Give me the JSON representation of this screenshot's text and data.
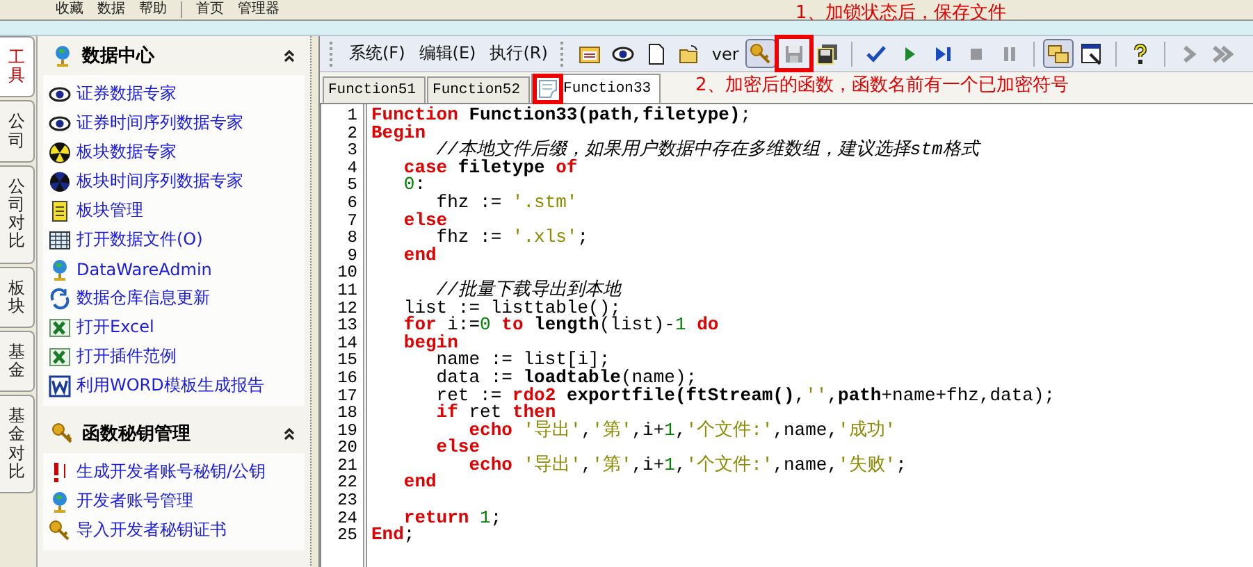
{
  "top_bar": {
    "menus": [
      "收藏",
      "数据",
      "帮助"
    ],
    "tabs": [
      "首页",
      "管理器"
    ]
  },
  "side_tabs": [
    {
      "label": "工具",
      "selected": true
    },
    {
      "label": "公司",
      "selected": false
    },
    {
      "label": "公司对比",
      "selected": false
    },
    {
      "label": "板块",
      "selected": false
    },
    {
      "label": "基金",
      "selected": false
    },
    {
      "label": "基金对比",
      "selected": false
    }
  ],
  "sections": [
    {
      "title": "数据中心",
      "kind": "globe",
      "expanded": true,
      "items": [
        {
          "label": "证券数据专家",
          "kind": "eye"
        },
        {
          "label": "证券时间序列数据专家",
          "kind": "eye"
        },
        {
          "label": "板块数据专家",
          "kind": "radiation"
        },
        {
          "label": "板块时间序列数据专家",
          "kind": "dark-radiation"
        },
        {
          "label": "板块管理",
          "kind": "note"
        },
        {
          "label": "打开数据文件(O)",
          "kind": "grid"
        },
        {
          "label": "DataWareAdmin",
          "kind": "globe"
        },
        {
          "label": "数据仓库信息更新",
          "kind": "refresh"
        },
        {
          "label": "打开Excel",
          "kind": "excel"
        },
        {
          "label": "打开插件范例",
          "kind": "excel"
        },
        {
          "label": "利用WORD模板生成报告",
          "kind": "word"
        }
      ]
    },
    {
      "title": "函数秘钥管理",
      "kind": "key",
      "expanded": true,
      "items": [
        {
          "label": "生成开发者账号秘钥/公钥",
          "kind": "alert"
        },
        {
          "label": "开发者账号管理",
          "kind": "globe"
        },
        {
          "label": "导入开发者秘钥证书",
          "kind": "key"
        }
      ]
    }
  ],
  "menu": [
    "系统(F)",
    "编辑(E)",
    "执行(R)"
  ],
  "toolbar": [
    {
      "kind": "calendar",
      "pressed": false,
      "disabled": false
    },
    {
      "kind": "eye",
      "pressed": false,
      "disabled": false
    },
    {
      "kind": "new",
      "pressed": false,
      "disabled": false
    },
    {
      "kind": "open",
      "pressed": false,
      "disabled": false
    },
    {
      "kind": "text",
      "label": "ver",
      "pressed": false,
      "disabled": false
    },
    {
      "kind": "key",
      "pressed": true,
      "disabled": false
    },
    {
      "kind": "save",
      "pressed": false,
      "disabled": true,
      "highlighted": true
    },
    {
      "kind": "save-all",
      "pressed": false,
      "disabled": false
    },
    {
      "kind": "sep"
    },
    {
      "kind": "check",
      "pressed": false,
      "disabled": false
    },
    {
      "kind": "play",
      "pressed": false,
      "disabled": false
    },
    {
      "kind": "step",
      "pressed": false,
      "disabled": false
    },
    {
      "kind": "stop",
      "pressed": false,
      "disabled": true
    },
    {
      "kind": "pause",
      "pressed": false,
      "disabled": true
    },
    {
      "kind": "sep"
    },
    {
      "kind": "folders",
      "pressed": true,
      "disabled": false
    },
    {
      "kind": "window",
      "pressed": false,
      "disabled": false
    },
    {
      "kind": "sep"
    },
    {
      "kind": "help",
      "pressed": false,
      "disabled": false
    },
    {
      "kind": "sep"
    },
    {
      "kind": "next",
      "pressed": false,
      "disabled": true
    },
    {
      "kind": "last",
      "pressed": false,
      "disabled": true
    }
  ],
  "tabs": [
    {
      "label": "Function51",
      "selected": false,
      "encrypted": false
    },
    {
      "label": "Function52",
      "selected": false,
      "encrypted": false
    },
    {
      "label": "Function33",
      "selected": true,
      "encrypted": true,
      "highlighted": true
    }
  ],
  "annotations": [
    "1、加锁状态后，保存文件",
    "2、加密后的函数，函数名前有一个已加密符号"
  ],
  "code": [
    {
      "number": "1",
      "tokens": [
        {
          "kind": "kw",
          "text": "Function"
        },
        {
          "kind": "id",
          "text": " Function33(path,filetype)"
        },
        {
          "kind": "tx",
          "text": ";"
        }
      ]
    },
    {
      "number": "2",
      "tokens": [
        {
          "kind": "kw",
          "text": "Begin"
        }
      ]
    },
    {
      "number": "3",
      "tokens": [
        {
          "kind": "cm",
          "text": "      //本地文件后缀，如果用户数据中存在多维数组，建议选择stm格式"
        }
      ]
    },
    {
      "number": "4",
      "tokens": [
        {
          "kind": "kw",
          "text": "   case"
        },
        {
          "kind": "id",
          "text": " filetype"
        },
        {
          "kind": "kw",
          "text": " of"
        }
      ]
    },
    {
      "number": "5",
      "tokens": [
        {
          "kind": "num",
          "text": "   0"
        },
        {
          "kind": "tx",
          "text": ":"
        }
      ]
    },
    {
      "number": "6",
      "tokens": [
        {
          "kind": "tx",
          "text": "      fhz := "
        },
        {
          "kind": "str",
          "text": "'.stm'"
        }
      ]
    },
    {
      "number": "7",
      "tokens": [
        {
          "kind": "kw",
          "text": "   else"
        }
      ]
    },
    {
      "number": "8",
      "tokens": [
        {
          "kind": "tx",
          "text": "      fhz := "
        },
        {
          "kind": "str",
          "text": "'.xls'"
        },
        {
          "kind": "tx",
          "text": ";"
        }
      ]
    },
    {
      "number": "9",
      "tokens": [
        {
          "kind": "kw",
          "text": "   end"
        }
      ]
    },
    {
      "number": "10"
    },
    {
      "number": "11",
      "tokens": [
        {
          "kind": "cm",
          "text": "      //批量下载导出到本地"
        }
      ]
    },
    {
      "number": "12",
      "tokens": [
        {
          "kind": "tx",
          "text": "   list := listtable();"
        }
      ]
    },
    {
      "number": "13",
      "tokens": [
        {
          "kind": "kw",
          "text": "   for"
        },
        {
          "kind": "tx",
          "text": " i:="
        },
        {
          "kind": "num",
          "text": "0"
        },
        {
          "kind": "kw",
          "text": " to"
        },
        {
          "kind": "id",
          "text": " length"
        },
        {
          "kind": "tx",
          "text": "(list)-"
        },
        {
          "kind": "num",
          "text": "1"
        },
        {
          "kind": "kw",
          "text": " do"
        }
      ]
    },
    {
      "number": "14",
      "tokens": [
        {
          "kind": "kw",
          "text": "   begin"
        }
      ]
    },
    {
      "number": "15",
      "tokens": [
        {
          "kind": "tx",
          "text": "      name := list[i];"
        }
      ]
    },
    {
      "number": "16",
      "tokens": [
        {
          "kind": "tx",
          "text": "      data := "
        },
        {
          "kind": "id",
          "text": "loadtable"
        },
        {
          "kind": "tx",
          "text": "(name);"
        }
      ]
    },
    {
      "number": "17",
      "tokens": [
        {
          "kind": "tx",
          "text": "      ret := "
        },
        {
          "kind": "kw",
          "text": "rdo2"
        },
        {
          "kind": "id",
          "text": " exportfile(ftStream()"
        },
        {
          "kind": "tx",
          "text": ","
        },
        {
          "kind": "str",
          "text": "''"
        },
        {
          "kind": "tx",
          "text": ","
        },
        {
          "kind": "id",
          "text": "path"
        },
        {
          "kind": "tx",
          "text": "+name+fhz,data);"
        }
      ]
    },
    {
      "number": "18",
      "tokens": [
        {
          "kind": "kw",
          "text": "      if"
        },
        {
          "kind": "tx",
          "text": " ret "
        },
        {
          "kind": "kw",
          "text": "then"
        }
      ]
    },
    {
      "number": "19",
      "tokens": [
        {
          "kind": "kw",
          "text": "         echo"
        },
        {
          "kind": "str",
          "text": " '导出'"
        },
        {
          "kind": "tx",
          "text": ","
        },
        {
          "kind": "str",
          "text": "'第'"
        },
        {
          "kind": "tx",
          "text": ",i+"
        },
        {
          "kind": "num",
          "text": "1"
        },
        {
          "kind": "tx",
          "text": ","
        },
        {
          "kind": "str",
          "text": "'个文件:'"
        },
        {
          "kind": "tx",
          "text": ",name,"
        },
        {
          "kind": "str",
          "text": "'成功'"
        }
      ]
    },
    {
      "number": "20",
      "tokens": [
        {
          "kind": "kw",
          "text": "      else"
        }
      ]
    },
    {
      "number": "21",
      "tokens": [
        {
          "kind": "kw",
          "text": "         echo"
        },
        {
          "kind": "str",
          "text": " '导出'"
        },
        {
          "kind": "tx",
          "text": ","
        },
        {
          "kind": "str",
          "text": "'第'"
        },
        {
          "kind": "tx",
          "text": ",i+"
        },
        {
          "kind": "num",
          "text": "1"
        },
        {
          "kind": "tx",
          "text": ","
        },
        {
          "kind": "str",
          "text": "'个文件:'"
        },
        {
          "kind": "tx",
          "text": ",name,"
        },
        {
          "kind": "str",
          "text": "'失败'"
        },
        {
          "kind": "tx",
          "text": ";"
        }
      ]
    },
    {
      "number": "22",
      "tokens": [
        {
          "kind": "kw",
          "text": "   end"
        }
      ]
    },
    {
      "number": "23"
    },
    {
      "number": "24",
      "tokens": [
        {
          "kind": "kw",
          "text": "   return"
        },
        {
          "kind": "num",
          "text": " 1"
        },
        {
          "kind": "tx",
          "text": ";"
        }
      ]
    },
    {
      "number": "25",
      "tokens": [
        {
          "kind": "kw",
          "text": "End"
        },
        {
          "kind": "tx",
          "text": ";"
        }
      ]
    }
  ]
}
